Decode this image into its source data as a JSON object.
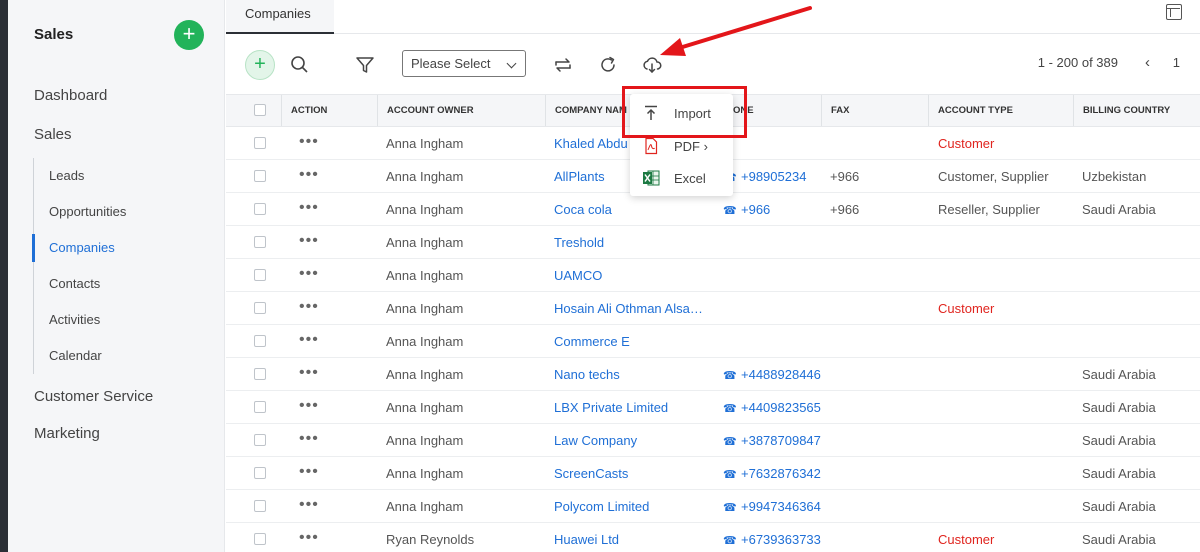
{
  "sidebar": {
    "title": "Sales",
    "top_items": [
      {
        "label": "Dashboard"
      },
      {
        "label": "Sales"
      }
    ],
    "sub_items": [
      {
        "label": "Leads"
      },
      {
        "label": "Opportunities"
      },
      {
        "label": "Companies"
      },
      {
        "label": "Contacts"
      },
      {
        "label": "Activities"
      },
      {
        "label": "Calendar"
      }
    ],
    "bottom_items": [
      {
        "label": "Customer Service"
      },
      {
        "label": "Marketing"
      }
    ],
    "active_item": "Companies"
  },
  "tab": {
    "label": "Companies"
  },
  "toolbar": {
    "select_value": "Please Select",
    "pagination": "1 - 200 of 389",
    "page_number": "1"
  },
  "columns": [
    "ACTION",
    "ACCOUNT OWNER",
    "COMPANY NAM",
    "ONE",
    "FAX",
    "ACCOUNT TYPE",
    "BILLING COUNTRY"
  ],
  "rows": [
    {
      "owner": "Anna Ingham",
      "company": "Khaled Abdu",
      "phone": "",
      "fax": "",
      "type": "Customer",
      "country": ""
    },
    {
      "owner": "Anna Ingham",
      "company": "AllPlants",
      "phone": "+98905234",
      "fax": "+966",
      "type": "Customer, Supplier",
      "country": "Uzbekistan"
    },
    {
      "owner": "Anna Ingham",
      "company": "Coca cola",
      "phone": "+966",
      "fax": "+966",
      "type": "Reseller, Supplier",
      "country": "Saudi Arabia"
    },
    {
      "owner": "Anna Ingham",
      "company": "Treshold",
      "phone": "",
      "fax": "",
      "type": "",
      "country": ""
    },
    {
      "owner": "Anna Ingham",
      "company": "UAMCO",
      "phone": "",
      "fax": "",
      "type": "",
      "country": ""
    },
    {
      "owner": "Anna Ingham",
      "company": "Hosain Ali Othman Alsa…",
      "phone": "",
      "fax": "",
      "type": "Customer",
      "country": ""
    },
    {
      "owner": "Anna Ingham",
      "company": "Commerce E",
      "phone": "",
      "fax": "",
      "type": "",
      "country": ""
    },
    {
      "owner": "Anna Ingham",
      "company": "Nano techs",
      "phone": "+4488928446",
      "fax": "",
      "type": "",
      "country": "Saudi Arabia"
    },
    {
      "owner": "Anna Ingham",
      "company": "LBX Private Limited",
      "phone": "+4409823565",
      "fax": "",
      "type": "",
      "country": "Saudi Arabia"
    },
    {
      "owner": "Anna Ingham",
      "company": "Law Company",
      "phone": "+3878709847",
      "fax": "",
      "type": "",
      "country": "Saudi Arabia"
    },
    {
      "owner": "Anna Ingham",
      "company": "ScreenCasts",
      "phone": "+7632876342",
      "fax": "",
      "type": "",
      "country": "Saudi Arabia"
    },
    {
      "owner": "Anna Ingham",
      "company": "Polycom Limited",
      "phone": "+9947346364",
      "fax": "",
      "type": "",
      "country": "Saudi Arabia"
    },
    {
      "owner": "Ryan Reynolds",
      "company": "Huawei Ltd",
      "phone": "+6739363733",
      "fax": "",
      "type": "Customer",
      "country": "Saudi Arabia"
    }
  ],
  "dropdown": {
    "items": [
      {
        "label": "Import",
        "icon": "upload-icon"
      },
      {
        "label": "PDF ›",
        "icon": "pdf-icon"
      },
      {
        "label": "Excel",
        "icon": "excel-icon"
      }
    ]
  },
  "colors": {
    "accent": "#1f6fd6",
    "add_green": "#22b35a",
    "highlight_red": "#e3161a",
    "customer_red": "#e0251f"
  }
}
